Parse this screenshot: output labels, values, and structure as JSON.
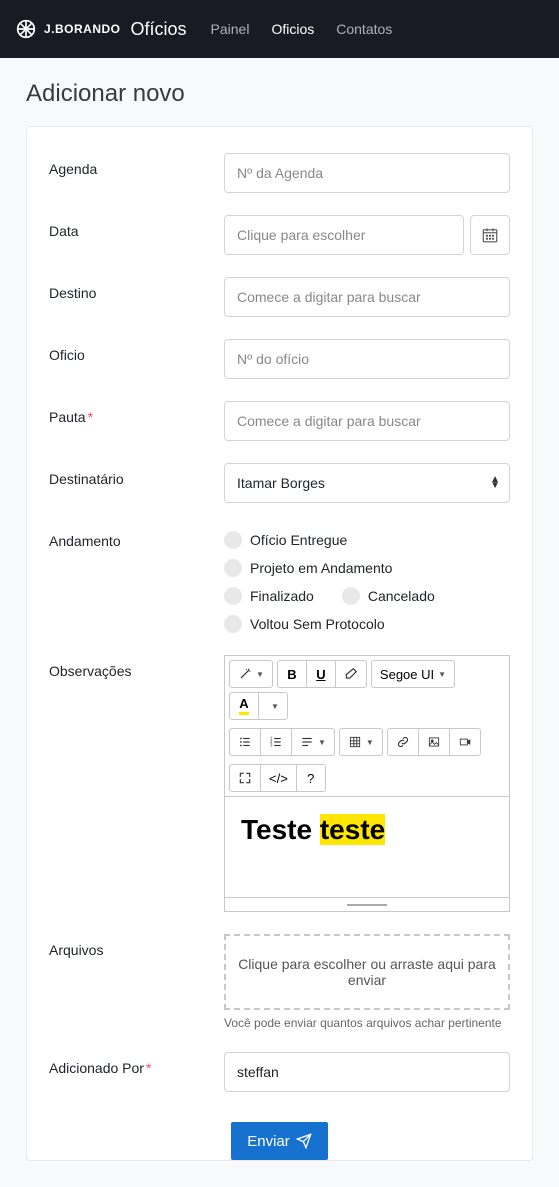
{
  "nav": {
    "brand_text": "J.BORANDO",
    "brand_title": "Ofícios",
    "links": [
      "Painel",
      "Oficios",
      "Contatos"
    ],
    "active_index": 1
  },
  "page": {
    "title": "Adicionar novo"
  },
  "form": {
    "agenda": {
      "label": "Agenda",
      "placeholder": "Nº da Agenda"
    },
    "data": {
      "label": "Data",
      "placeholder": "Clique para escolher"
    },
    "destino": {
      "label": "Destino",
      "placeholder": "Comece a digitar para buscar"
    },
    "oficio": {
      "label": "Oficio",
      "placeholder": "Nº do ofício"
    },
    "pauta": {
      "label": "Pauta",
      "placeholder": "Comece a digitar para buscar"
    },
    "destinatario": {
      "label": "Destinatário",
      "value": "Itamar Borges"
    },
    "andamento": {
      "label": "Andamento",
      "options": [
        "Ofício Entregue",
        "Projeto em Andamento",
        "Finalizado",
        "Cancelado",
        "Voltou Sem Protocolo"
      ]
    },
    "observacoes": {
      "label": "Observações",
      "font_name": "Segoe UI",
      "content_plain": "Teste ",
      "content_highlight": "teste"
    },
    "arquivos": {
      "label": "Arquivos",
      "dropzone_text": "Clique para escolher ou arraste aqui para enviar",
      "help": "Você pode enviar quantos arquivos achar pertinente"
    },
    "adicionado_por": {
      "label": "Adicionado Por",
      "value": "steffan"
    },
    "submit_label": "Enviar"
  },
  "icons": {
    "calendar": "calendar-icon",
    "magic": "magic-wand-icon",
    "bold": "B",
    "underline": "U",
    "eraser": "eraser-icon",
    "ul": "list-ul-icon",
    "ol": "list-ol-icon",
    "para": "paragraph-icon",
    "table": "table-icon",
    "link": "link-icon",
    "picture": "picture-icon",
    "video": "video-icon",
    "fullscreen": "fullscreen-icon",
    "code": "</>",
    "help": "?"
  }
}
